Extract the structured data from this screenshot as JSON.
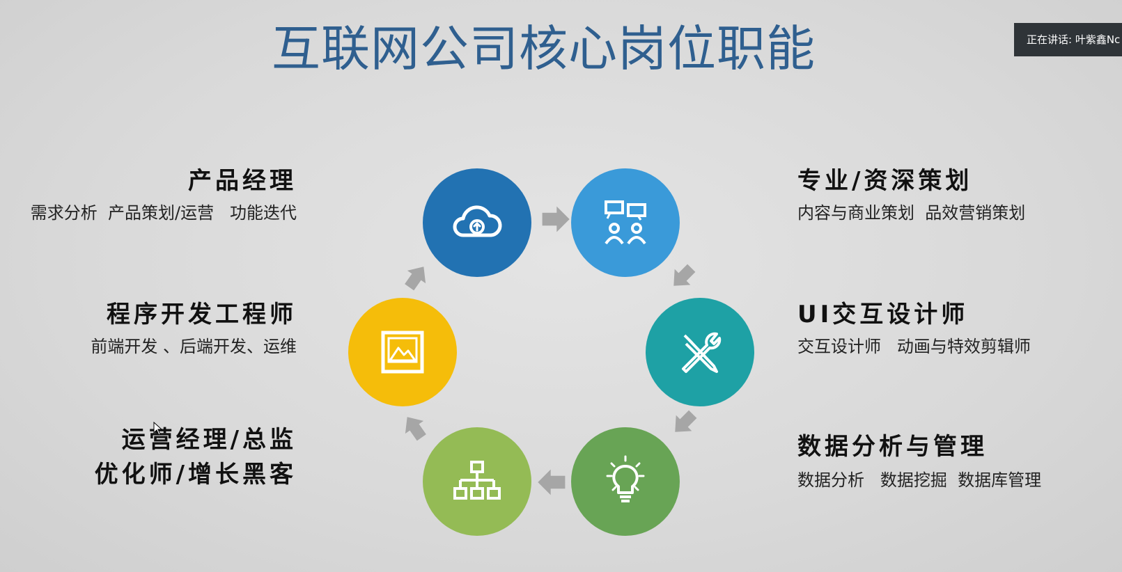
{
  "title": "互联网公司核心岗位职能",
  "speaker_badge": "正在讲话: 叶紫鑫Nc",
  "roles": {
    "product_manager": {
      "title": "产品经理",
      "desc": "需求分析  产品策划/运营   功能迭代"
    },
    "planner": {
      "title": "专业/资深策划",
      "desc": "内容与商业策划  品效营销策划"
    },
    "developer": {
      "title": "程序开发工程师",
      "desc": "前端开发 、后端开发、运维"
    },
    "ui_designer": {
      "title": "UI交互设计师",
      "desc": "交互设计师   动画与特效剪辑师"
    },
    "operations": {
      "title_line1": "运营经理/总监",
      "title_line2": "优化师/增长黑客"
    },
    "data": {
      "title": "数据分析与管理",
      "desc": "数据分析   数据挖掘  数据库管理"
    }
  },
  "colors": {
    "cloud_circle": "#2272b2",
    "team_circle": "#3a9ad9",
    "tools_circle": "#1ea1a5",
    "idea_circle": "#68a455",
    "hierarchy_circle": "#94bb55",
    "image_circle": "#f5bd0a",
    "arrow": "#a6a6a6",
    "title_text": "#2f5f8f"
  },
  "icons": [
    "cloud-upload-icon",
    "team-presentation-icon",
    "tools-icon",
    "lightbulb-icon",
    "org-chart-icon",
    "image-icon"
  ]
}
